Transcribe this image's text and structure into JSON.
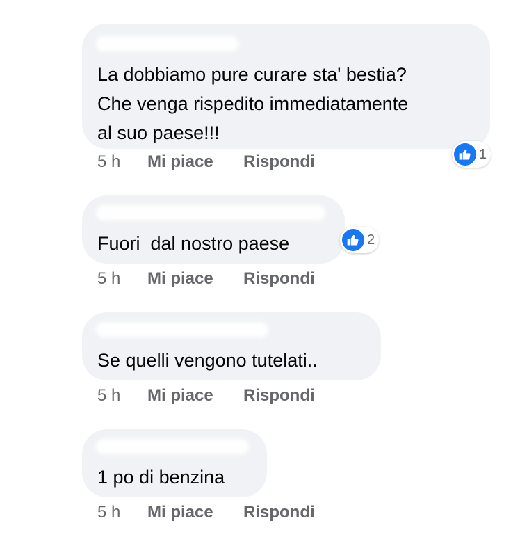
{
  "comments": [
    {
      "text": "La dobbiamo pure curare sta' bestia?\nChe venga rispedito immediatamente\nal suo paese!!!",
      "time": "5 h",
      "like_label": "Mi piace",
      "reply_label": "Rispondi",
      "reactions": {
        "icon": "thumbs-up-icon",
        "count": "1"
      }
    },
    {
      "text": "Fuori  dal nostro paese",
      "time": "5 h",
      "like_label": "Mi piace",
      "reply_label": "Rispondi",
      "reactions": {
        "icon": "thumbs-up-icon",
        "count": "2"
      }
    },
    {
      "text": "Se quelli vengono tutelati..",
      "time": "5 h",
      "like_label": "Mi piace",
      "reply_label": "Rispondi"
    },
    {
      "text": "1 po di benzina",
      "time": "5 h",
      "like_label": "Mi piace",
      "reply_label": "Rispondi"
    }
  ],
  "colors": {
    "bubble": "#f0f2f5",
    "text": "#050505",
    "meta": "#65676b",
    "like_blue": "#1877f2"
  }
}
